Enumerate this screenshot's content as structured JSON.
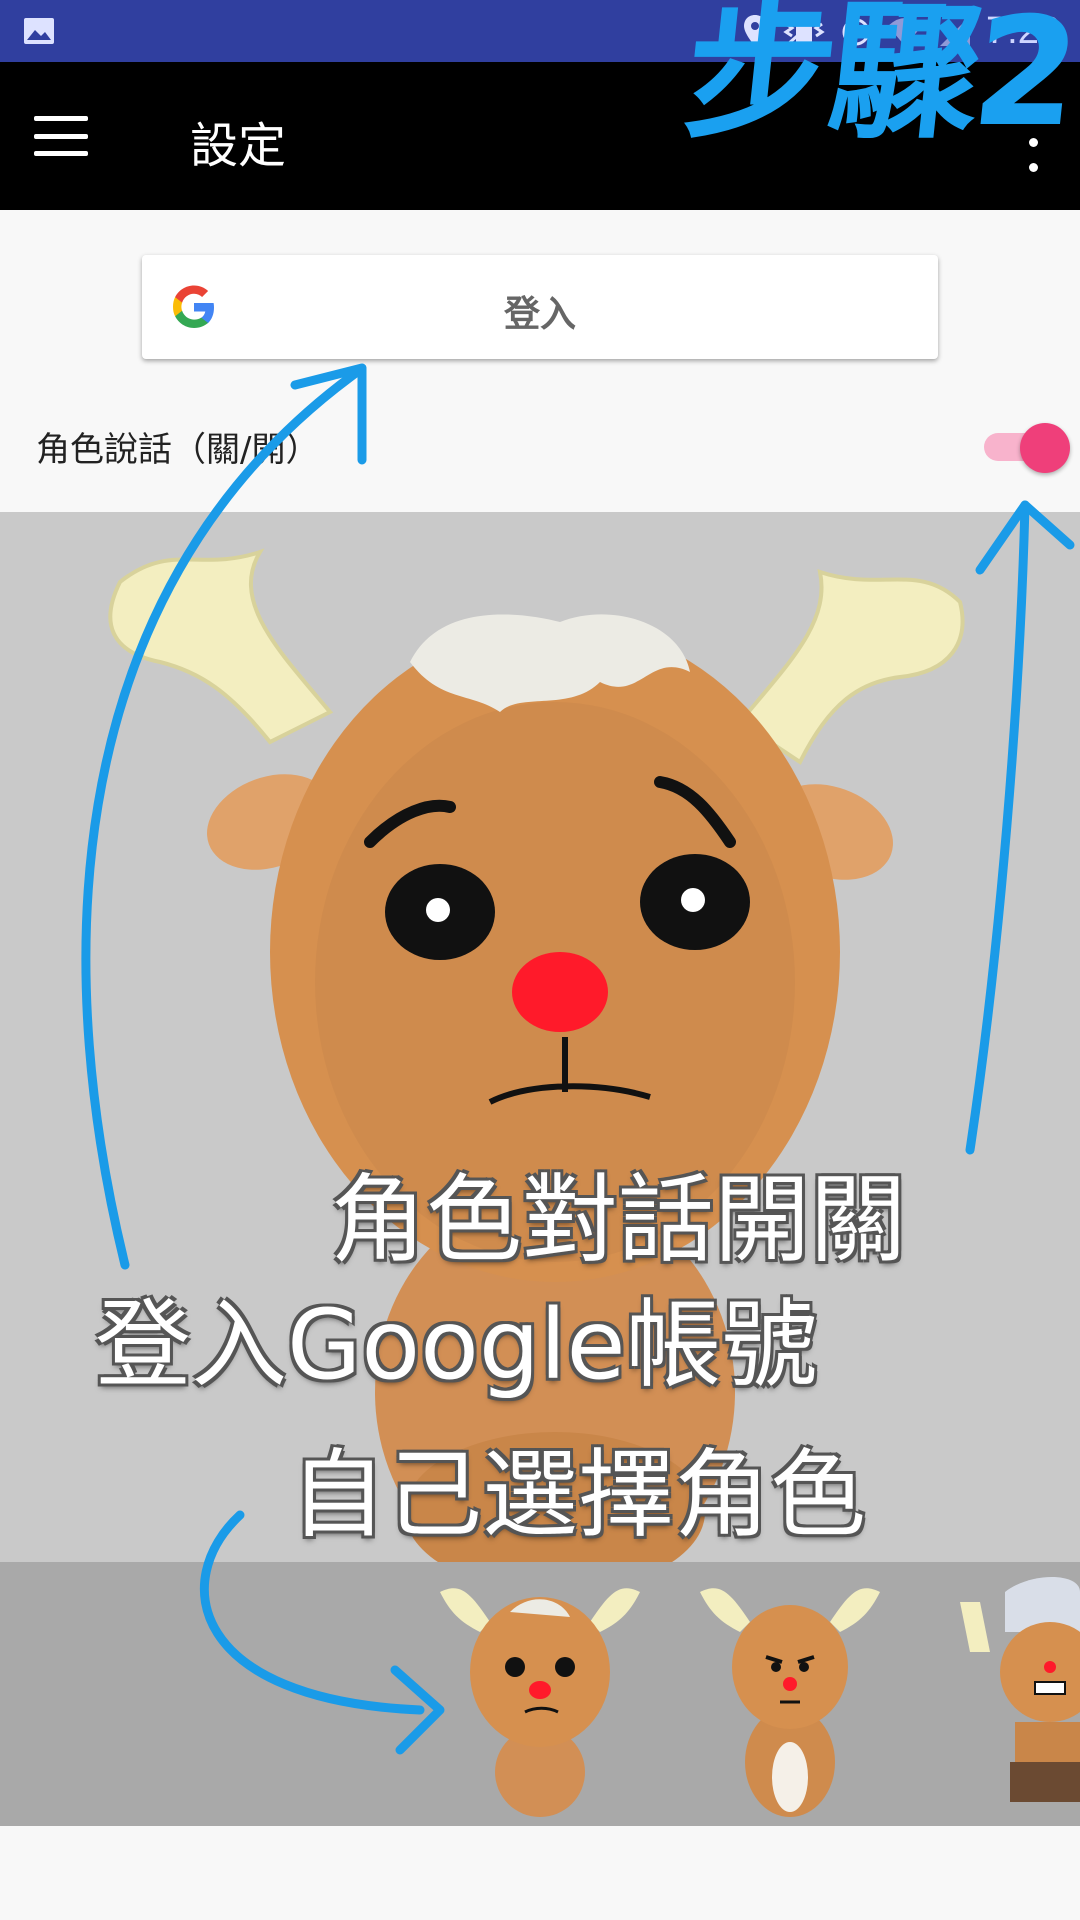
{
  "status_bar": {
    "time": "7:28",
    "icons": [
      "gallery-icon",
      "location-icon",
      "vibrate-icon",
      "alarm-icon",
      "wifi-icon",
      "signal-icon",
      "battery-icon"
    ]
  },
  "app_bar": {
    "title": "設定",
    "menu_icon": "hamburger-menu-icon",
    "overflow_icon": "more-vert-icon"
  },
  "annotation": {
    "step": "步驟2",
    "dialog_toggle": "角色對話開關",
    "google_login": "登入Google帳號",
    "choose_character": "自己選擇角色"
  },
  "settings": {
    "signin_button_label": "登入",
    "character_speech_label": "角色說話（關/開）",
    "character_speech_enabled": true
  },
  "character_picker": {
    "selected_index": 0
  },
  "colors": {
    "status_bar": "#303f9f",
    "app_bar": "#000000",
    "toggle_accent": "#ef3f7a",
    "annotation_blue": "#1aa0f0",
    "character_bg": "#c9c9c9",
    "picker_bg": "#a9a9a9"
  }
}
